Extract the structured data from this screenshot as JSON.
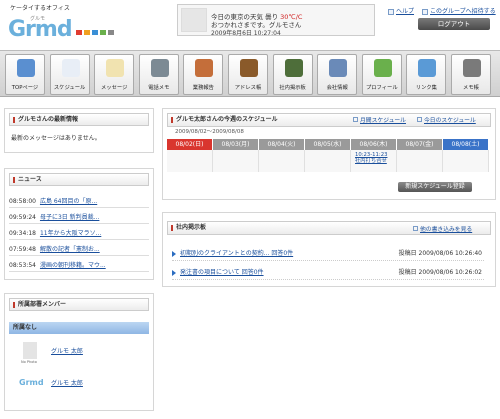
{
  "header": {
    "tagline": "ケータイするオフィス",
    "logo_text": "Grmd",
    "logo_kana": "グルモ",
    "weather_line1_prefix": "今日の東京の天気 曇り ",
    "weather_temp": "30℃/C",
    "weather_line2": "おつかれさまです。グルモさん",
    "datetime": "2009年8月6日  10:27:04",
    "link_help": "ヘルプ",
    "link_group": "このグループへ招待する",
    "logout_label": "ログアウト"
  },
  "nav": [
    {
      "label": "TOPページ",
      "icon": "house-icon",
      "color": "#5a8fd0"
    },
    {
      "label": "スケジュール",
      "icon": "calendar-icon",
      "color": "#e8eef6"
    },
    {
      "label": "メッセージ",
      "icon": "envelope-icon",
      "color": "#f1e3b0"
    },
    {
      "label": "電話メモ",
      "icon": "phone-icon",
      "color": "#7c8a94"
    },
    {
      "label": "業務報告",
      "icon": "report-icon",
      "color": "#c46e3a"
    },
    {
      "label": "アドレス帳",
      "icon": "address-book-icon",
      "color": "#8a5a2a"
    },
    {
      "label": "社内掲示板",
      "icon": "bulletin-board-icon",
      "color": "#4e6e3a"
    },
    {
      "label": "会社情報",
      "icon": "building-icon",
      "color": "#6a8ab8"
    },
    {
      "label": "プロフィール",
      "icon": "profile-icon",
      "color": "#6ab04c"
    },
    {
      "label": "リンク集",
      "icon": "link-icon",
      "color": "#5a9ad6"
    },
    {
      "label": "メモ帳",
      "icon": "memo-icon",
      "color": "#7a7a7a"
    }
  ],
  "latest": {
    "title": "グルモさんの最新情報",
    "text": "最新のメッセージはありません。"
  },
  "news": {
    "title": "ニュース",
    "items": [
      {
        "time": "08:58:00",
        "text": "広島 64回目の「原..."
      },
      {
        "time": "09:59:24",
        "text": "母子に3日 新判員裁..."
      },
      {
        "time": "09:34:18",
        "text": "11年から大阪マラソ..."
      },
      {
        "time": "07:59:48",
        "text": "解散の記者「憲制お..."
      },
      {
        "time": "08:53:54",
        "text": "漫画の朝刊移籍。マウ..."
      }
    ]
  },
  "members": {
    "title": "所属部署メンバー",
    "group": "所属なし",
    "list": [
      {
        "name": "グルモ 太郎",
        "avatar_caption": "No Photo"
      },
      {
        "name": "グルモ 太郎",
        "avatar_caption": "Grmd"
      }
    ]
  },
  "schedule": {
    "title": "グルモ太郎さんの今週のスケジュール",
    "range": "2009/08/02～2009/08/08",
    "link_month": "月間スケジュール",
    "link_today": "今日のスケジュール",
    "days": [
      "08/02(日)",
      "08/03(月)",
      "08/04(火)",
      "08/05(水)",
      "08/06(木)",
      "08/07(金)",
      "08/08(土)"
    ],
    "event_time": "10:23-11:23",
    "event_text": "社内打ち合せ",
    "new_button": "新規スケジュール登録",
    "colors": {
      "sunday": "#d9352e",
      "saturday": "#3a73c8",
      "weekday": "#9a9a9a"
    }
  },
  "bulletin": {
    "title": "社内掲示板",
    "link_all": "他の書き込みを見る",
    "items": [
      {
        "text": "初期別のクライアントとの契約... 回答0件",
        "meta": "投稿日 2009/08/06 10:26:40"
      },
      {
        "text": "発注書の項目について 回答0件",
        "meta": "投稿日 2009/08/06 10:26:02"
      }
    ]
  }
}
